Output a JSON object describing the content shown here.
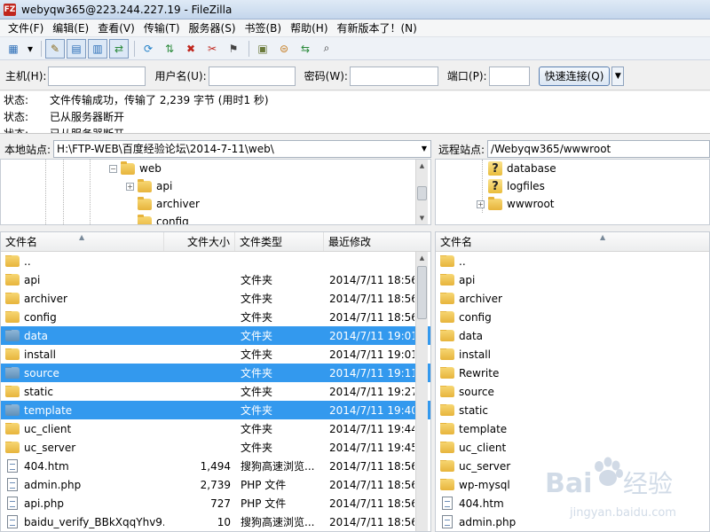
{
  "window": {
    "title": "webyqw365@223.244.227.19 - FileZilla",
    "app_icon_text": "FZ"
  },
  "menu": [
    "文件(F)",
    "编辑(E)",
    "查看(V)",
    "传输(T)",
    "服务器(S)",
    "书签(B)",
    "帮助(H)",
    "有新版本了！(N)"
  ],
  "toolbar": {
    "buttons": [
      {
        "name": "site-manager-icon",
        "glyph": "▦"
      },
      {
        "name": "dropdown-arrow-icon",
        "glyph": "▾"
      },
      {
        "name": "toggle-log-icon",
        "glyph": "✎"
      },
      {
        "name": "toggle-local-tree-icon",
        "glyph": "▤"
      },
      {
        "name": "toggle-remote-tree-icon",
        "glyph": "▥"
      },
      {
        "name": "toggle-queue-icon",
        "glyph": "⇄"
      },
      {
        "name": "refresh-icon",
        "glyph": "⟳"
      },
      {
        "name": "process-queue-icon",
        "glyph": "⇅"
      },
      {
        "name": "cancel-icon",
        "glyph": "✖"
      },
      {
        "name": "disconnect-icon",
        "glyph": "✂"
      },
      {
        "name": "reconnect-icon",
        "glyph": "⚑"
      },
      {
        "name": "filter-icon",
        "glyph": "▣"
      },
      {
        "name": "compare-icon",
        "glyph": "⊜"
      },
      {
        "name": "sync-browse-icon",
        "glyph": "⇆"
      },
      {
        "name": "search-icon",
        "glyph": "⌕"
      }
    ]
  },
  "quickconnect": {
    "host_label": "主机(H):",
    "user_label": "用户名(U):",
    "pass_label": "密码(W):",
    "port_label": "端口(P):",
    "connect_label": "快速连接(Q)",
    "host_value": "",
    "user_value": "",
    "pass_value": "",
    "port_value": ""
  },
  "log": [
    {
      "label": "状态:",
      "text": "文件传输成功，传输了 2,239 字节 (用时1 秒)"
    },
    {
      "label": "状态:",
      "text": "已从服务器断开"
    },
    {
      "label": "状态:",
      "text": "已从服务器断开"
    }
  ],
  "local": {
    "site_label": "本地站点:",
    "path": "H:\\FTP-WEB\\百度经验论坛\\2014-7-11\\web\\",
    "tree": [
      {
        "label": "web",
        "expander": "−"
      },
      {
        "label": "api",
        "expander": "+"
      },
      {
        "label": "archiver",
        "expander": ""
      },
      {
        "label": "config",
        "expander": ""
      }
    ],
    "columns": [
      "文件名",
      "文件大小",
      "文件类型",
      "最近修改"
    ],
    "files": [
      {
        "name": "..",
        "size": "",
        "type": "",
        "date": "",
        "kind": "folder",
        "selected": false
      },
      {
        "name": "api",
        "size": "",
        "type": "文件夹",
        "date": "2014/7/11 18:56:",
        "kind": "folder",
        "selected": false
      },
      {
        "name": "archiver",
        "size": "",
        "type": "文件夹",
        "date": "2014/7/11 18:56:",
        "kind": "folder",
        "selected": false
      },
      {
        "name": "config",
        "size": "",
        "type": "文件夹",
        "date": "2014/7/11 18:56:",
        "kind": "folder",
        "selected": false
      },
      {
        "name": "data",
        "size": "",
        "type": "文件夹",
        "date": "2014/7/11 19:01:",
        "kind": "folder",
        "selected": true
      },
      {
        "name": "install",
        "size": "",
        "type": "文件夹",
        "date": "2014/7/11 19:01:",
        "kind": "folder",
        "selected": false
      },
      {
        "name": "source",
        "size": "",
        "type": "文件夹",
        "date": "2014/7/11 19:11:",
        "kind": "folder",
        "selected": true
      },
      {
        "name": "static",
        "size": "",
        "type": "文件夹",
        "date": "2014/7/11 19:27:",
        "kind": "folder",
        "selected": false
      },
      {
        "name": "template",
        "size": "",
        "type": "文件夹",
        "date": "2014/7/11 19:40:",
        "kind": "folder",
        "selected": true
      },
      {
        "name": "uc_client",
        "size": "",
        "type": "文件夹",
        "date": "2014/7/11 19:44:",
        "kind": "folder",
        "selected": false
      },
      {
        "name": "uc_server",
        "size": "",
        "type": "文件夹",
        "date": "2014/7/11 19:45:",
        "kind": "folder",
        "selected": false
      },
      {
        "name": "404.htm",
        "size": "1,494",
        "type": "搜狗高速浏览...",
        "date": "2014/7/11 18:56:",
        "kind": "file",
        "selected": false
      },
      {
        "name": "admin.php",
        "size": "2,739",
        "type": "PHP 文件",
        "date": "2014/7/11 18:56:",
        "kind": "file",
        "selected": false
      },
      {
        "name": "api.php",
        "size": "727",
        "type": "PHP 文件",
        "date": "2014/7/11 18:56:",
        "kind": "file",
        "selected": false
      },
      {
        "name": "baidu_verify_BBkXqqYhv9...",
        "size": "10",
        "type": "搜狗高速浏览...",
        "date": "2014/7/11 18:56:",
        "kind": "file",
        "selected": false
      }
    ]
  },
  "remote": {
    "site_label": "远程站点:",
    "path": "/Webyqw365/wwwroot",
    "tree": [
      {
        "label": "database",
        "expander": "",
        "icon": "unknown"
      },
      {
        "label": "logfiles",
        "expander": "",
        "icon": "unknown"
      },
      {
        "label": "wwwroot",
        "expander": "+",
        "icon": "folder"
      }
    ],
    "columns": [
      "文件名"
    ],
    "files": [
      {
        "name": "..",
        "kind": "folder"
      },
      {
        "name": "api",
        "kind": "folder"
      },
      {
        "name": "archiver",
        "kind": "folder"
      },
      {
        "name": "config",
        "kind": "folder"
      },
      {
        "name": "data",
        "kind": "folder"
      },
      {
        "name": "install",
        "kind": "folder"
      },
      {
        "name": "Rewrite",
        "kind": "folder"
      },
      {
        "name": "source",
        "kind": "folder"
      },
      {
        "name": "static",
        "kind": "folder"
      },
      {
        "name": "template",
        "kind": "folder"
      },
      {
        "name": "uc_client",
        "kind": "folder"
      },
      {
        "name": "uc_server",
        "kind": "folder"
      },
      {
        "name": "wp-mysql",
        "kind": "folder"
      },
      {
        "name": "404.htm",
        "kind": "file"
      },
      {
        "name": "admin.php",
        "kind": "file"
      }
    ]
  },
  "watermark": {
    "brand": "Bai",
    "brand_suffix": "经验",
    "url": "jingyan.baidu.com"
  }
}
